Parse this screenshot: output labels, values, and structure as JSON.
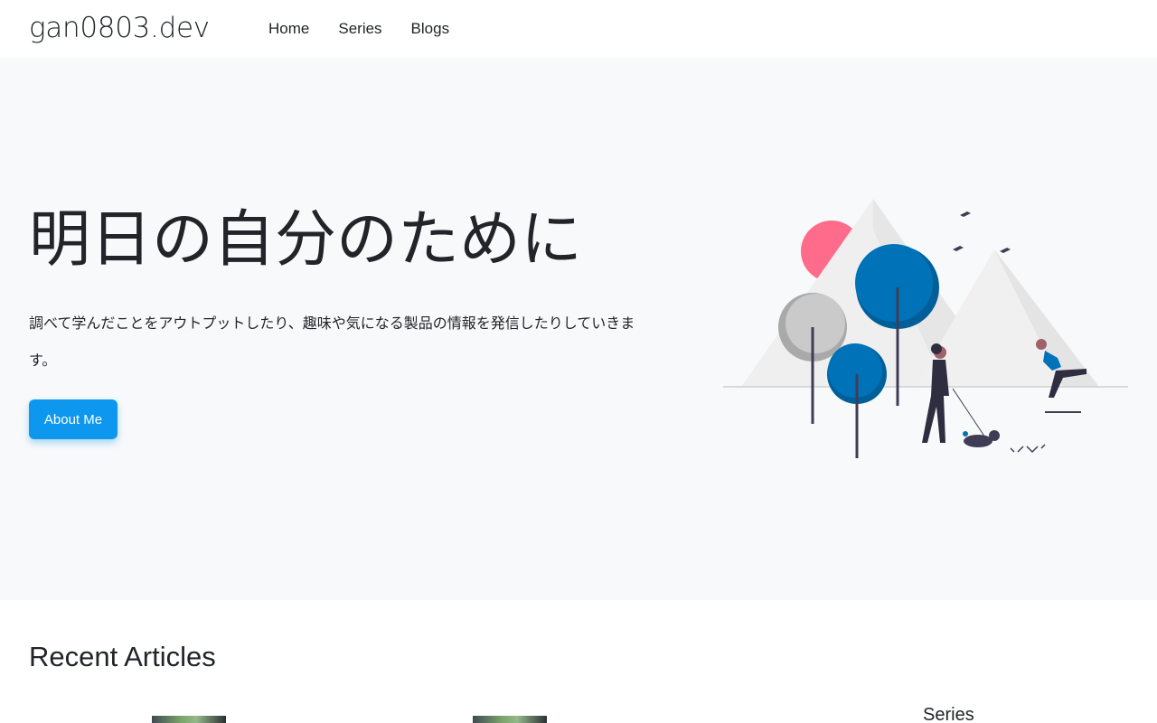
{
  "navbar": {
    "brand": "gan0803.dev",
    "links": [
      {
        "label": "Home"
      },
      {
        "label": "Series"
      },
      {
        "label": "Blogs"
      }
    ]
  },
  "hero": {
    "title": "明日の自分のために",
    "text": "調べて学んだことをアウトプットしたり、趣味や気になる製品の情報を発信したりしていきます。",
    "button_label": "About Me",
    "illustration": "outdoor-walk-illustration"
  },
  "recent": {
    "title": "Recent Articles",
    "thumbnails": [
      "article-thumbnail",
      "article-thumbnail"
    ]
  },
  "sidebar": {
    "series_label": "Series"
  },
  "colors": {
    "accent": "#0d97ee",
    "hero_bg": "#f8f9fa",
    "tree_blue": "#0072b8",
    "sun_pink": "#ff6b8b"
  }
}
